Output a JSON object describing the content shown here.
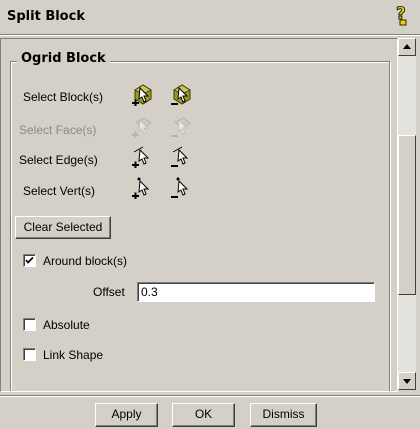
{
  "window": {
    "title": "Split Block"
  },
  "group": {
    "title": "Ogrid Block",
    "select_blocks_label": "Select Block(s)",
    "select_faces_label": "Select Face(s)",
    "select_edges_label": "Select Edge(s)",
    "select_verts_label": "Select Vert(s)",
    "clear_selected_label": "Clear Selected",
    "around_blocks": {
      "label": "Around block(s)",
      "checked": true
    },
    "offset": {
      "label": "Offset",
      "value": "0.3"
    },
    "absolute": {
      "label": "Absolute",
      "checked": false
    },
    "link_shape": {
      "label": "Link Shape",
      "checked": false
    }
  },
  "buttons": {
    "apply": "Apply",
    "ok": "OK",
    "dismiss": "Dismiss"
  },
  "icons": {
    "help": "help-icon",
    "select_block_add": "block-select-add-icon",
    "select_block_remove": "block-select-remove-icon",
    "select_face_add": "face-select-add-icon",
    "select_face_remove": "face-select-remove-icon",
    "select_edge_add": "edge-select-add-icon",
    "select_edge_remove": "edge-select-remove-icon",
    "select_vert_add": "vert-select-add-icon",
    "select_vert_remove": "vert-select-remove-icon"
  },
  "colors": {
    "background": "#d4d0c8",
    "disabled_text": "#8a8a8a",
    "icon_olive": "#7a7a00"
  }
}
